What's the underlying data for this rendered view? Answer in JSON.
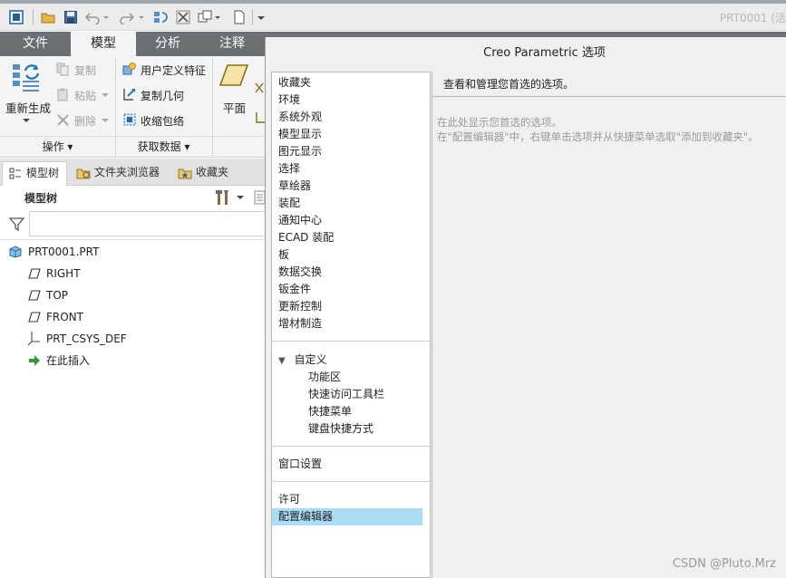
{
  "window": {
    "title": "PRT0001 (活"
  },
  "ribbon": {
    "tabs": [
      {
        "label": "文件"
      },
      {
        "label": "模型"
      },
      {
        "label": "分析"
      },
      {
        "label": "注释"
      }
    ],
    "regenerate_label": "重新生成",
    "copy_label": "复制",
    "paste_label": "粘贴",
    "delete_label": "删除",
    "udf_label": "用户定义特征",
    "copy_geometry_label": "复制几何",
    "shrinkwrap_label": "收缩包络",
    "plane_label": "平面",
    "group_operations_label": "操作",
    "group_get_data_label": "获取数据"
  },
  "navigator": {
    "tabs": [
      {
        "label": "模型树"
      },
      {
        "label": "文件夹浏览器"
      },
      {
        "label": "收藏夹"
      }
    ],
    "tree_title": "模型树",
    "filter_placeholder": ""
  },
  "model_tree": {
    "root": "PRT0001.PRT",
    "items": [
      {
        "label": "RIGHT",
        "icon": "datum-plane-icon"
      },
      {
        "label": "TOP",
        "icon": "datum-plane-icon"
      },
      {
        "label": "FRONT",
        "icon": "datum-plane-icon"
      },
      {
        "label": "PRT_CSYS_DEF",
        "icon": "csys-icon"
      },
      {
        "label": "在此插入",
        "icon": "insert-here-arrow-icon"
      }
    ]
  },
  "dialog": {
    "title": "Creo Parametric 选项",
    "categories": [
      "收藏夹",
      "环境",
      "系统外观",
      "模型显示",
      "图元显示",
      "选择",
      "草绘器",
      "装配",
      "通知中心",
      "ECAD 装配",
      "板",
      "数据交换",
      "钣金件",
      "更新控制",
      "增材制造"
    ],
    "customize": {
      "label": "自定义",
      "items": [
        "功能区",
        "快速访问工具栏",
        "快捷菜单",
        "键盘快捷方式"
      ]
    },
    "window_settings": "窗口设置",
    "license": "许可",
    "config_editor": "配置编辑器",
    "content_header": "查看和管理您首选的选项。",
    "hint_line1": "在此处显示您首选的选项。",
    "hint_line2": "在\"配置编辑器\"中，右键单击选项并从快捷菜单选取\"添加到收藏夹\"。"
  },
  "watermark": "CSDN @Pluto.Mrz",
  "colors": {
    "tab_bar": "#6b6e72",
    "selection": "#a9dcf5",
    "accent_blue": "#1f7ab8",
    "insert_arrow": "#2e9b2e"
  }
}
